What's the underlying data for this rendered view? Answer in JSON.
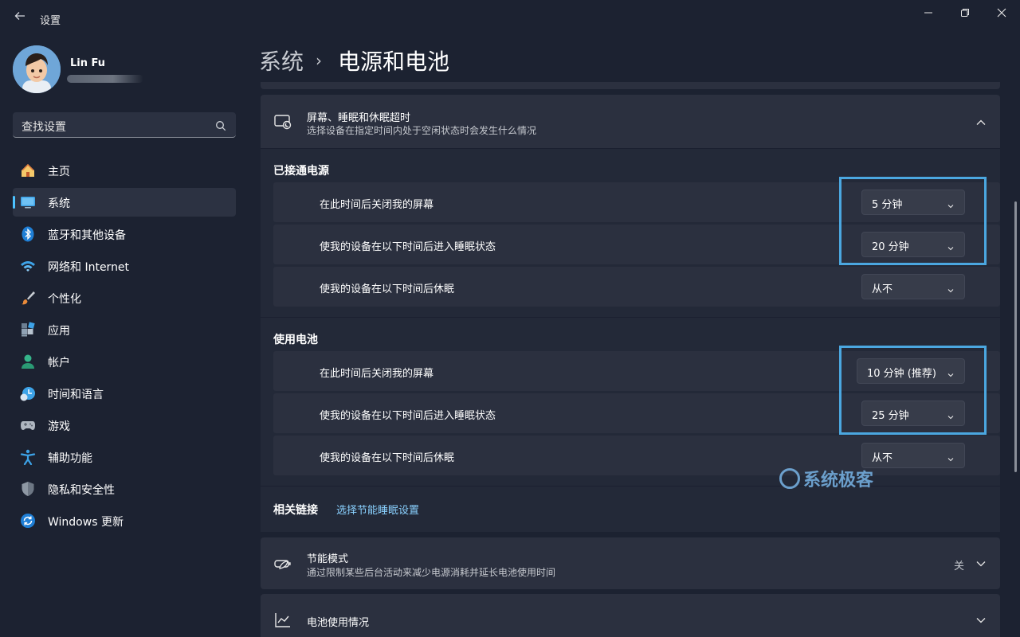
{
  "window": {
    "title": "设置",
    "controls": [
      "minimize-icon",
      "maximize-icon",
      "close-icon"
    ]
  },
  "user": {
    "name": "Lin Fu"
  },
  "search": {
    "placeholder": "查找设置"
  },
  "sidebar": {
    "items": [
      {
        "label": "主页",
        "icon": "home-icon",
        "active": false
      },
      {
        "label": "系统",
        "icon": "system-icon",
        "active": true
      },
      {
        "label": "蓝牙和其他设备",
        "icon": "bluetooth-icon",
        "active": false
      },
      {
        "label": "网络和 Internet",
        "icon": "wifi-icon",
        "active": false
      },
      {
        "label": "个性化",
        "icon": "brush-icon",
        "active": false
      },
      {
        "label": "应用",
        "icon": "apps-icon",
        "active": false
      },
      {
        "label": "帐户",
        "icon": "account-icon",
        "active": false
      },
      {
        "label": "时间和语言",
        "icon": "time-language-icon",
        "active": false
      },
      {
        "label": "游戏",
        "icon": "gamepad-icon",
        "active": false
      },
      {
        "label": "辅助功能",
        "icon": "accessibility-icon",
        "active": false
      },
      {
        "label": "隐私和安全性",
        "icon": "shield-icon",
        "active": false
      },
      {
        "label": "Windows 更新",
        "icon": "update-icon",
        "active": false
      }
    ]
  },
  "breadcrumb": {
    "parent": "系统",
    "separator": "›",
    "current": "电源和电池"
  },
  "screen_sleep": {
    "title": "屏幕、睡眠和休眠超时",
    "subtitle": "选择设备在指定时间内处于空闲状态时会发生什么情况",
    "plugged_in": {
      "heading": "已接通电源",
      "rows": [
        {
          "label": "在此时间后关闭我的屏幕",
          "value": "5 分钟"
        },
        {
          "label": "使我的设备在以下时间后进入睡眠状态",
          "value": "20 分钟"
        },
        {
          "label": "使我的设备在以下时间后休眠",
          "value": "从不"
        }
      ]
    },
    "battery": {
      "heading": "使用电池",
      "rows": [
        {
          "label": "在此时间后关闭我的屏幕",
          "value": "10 分钟 (推荐)"
        },
        {
          "label": "使我的设备在以下时间后进入睡眠状态",
          "value": "25 分钟"
        },
        {
          "label": "使我的设备在以下时间后休眠",
          "value": "从不"
        }
      ]
    },
    "related": {
      "label": "相关链接",
      "link": "选择节能睡眠设置"
    }
  },
  "energy_saver": {
    "title": "节能模式",
    "subtitle": "通过限制某些后台活动来减少电源消耗并延长电池使用时间",
    "state": "关"
  },
  "battery_usage": {
    "title": "电池使用情况"
  },
  "watermark": {
    "text": "系统极客"
  },
  "colors": {
    "accent": "#4cc2ff",
    "highlight_box": "#4ba7e0",
    "link": "#8ad1ff"
  }
}
